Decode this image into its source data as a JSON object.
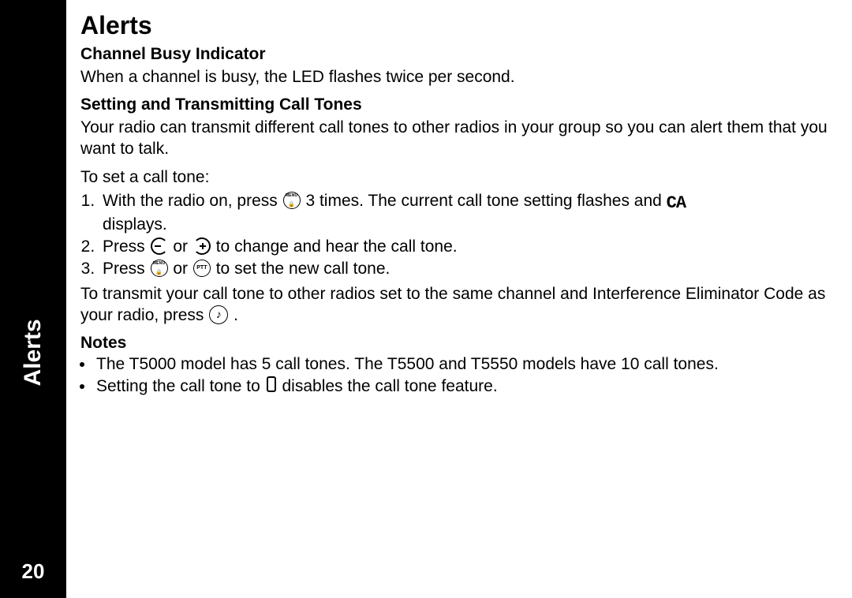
{
  "sidebar": {
    "section_label": "Alerts",
    "page_number": "20"
  },
  "title": "Alerts",
  "sub1": {
    "heading": "Channel Busy Indicator",
    "p1": "When a channel is busy, the LED flashes twice per second."
  },
  "sub2": {
    "heading": "Setting and Transmitting Call Tones",
    "intro": "Your radio can transmit different call tones to other radios in your group so you can alert them that you want to talk.",
    "lead": "To set a call tone:",
    "step1_a": "With the radio on, press ",
    "step1_b": "3 times. The current call tone setting flashes and ",
    "step1_c": " displays.",
    "step2_a": "Press ",
    "step2_or": "or ",
    "step2_b": "to change and hear the call tone.",
    "step3_a": "Press ",
    "step3_or": "or ",
    "step3_b": " to set the new call tone.",
    "transmit_a": "To transmit your call tone to other radios set to the same channel and Interference Eliminator Code as your radio, press ",
    "transmit_b": "."
  },
  "notes": {
    "heading": "Notes",
    "n1": "The T5000 model has 5 call tones. The T5500 and T5550 models have 10 call tones.",
    "n2_a": "Setting the call tone to ",
    "n2_b": " disables the call tone feature."
  },
  "icons": {
    "menu_label": "MENU",
    "ptt_label": "PTT",
    "ca_glyph": "CA"
  }
}
